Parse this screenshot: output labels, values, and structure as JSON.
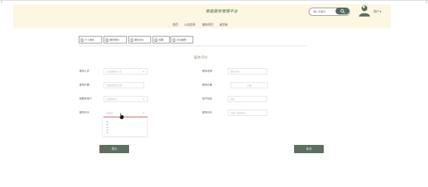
{
  "header": {
    "title": "家庭服务管理平台",
    "search_placeholder": "输入关键词",
    "username": "用户"
  },
  "nav": [
    "首页",
    "公告信息",
    "服务项目",
    "留言板"
  ],
  "tabs": [
    "个人首页",
    "服务预约",
    "服务评价",
    "收藏",
    "评论管理"
  ],
  "form": {
    "title": "服务评价",
    "fields": [
      {
        "label": "服务人员",
        "value": "请选择服务人员"
      },
      {
        "label": "服务名称",
        "value": "服务名称"
      },
      {
        "label": "服务日期",
        "value": "请选择服务日期"
      },
      {
        "label": "服务价格",
        "value": "价格"
      },
      {
        "label": "被服务用户",
        "value": "请选择用户"
      },
      {
        "label": "用户地址",
        "value": "地址"
      },
      {
        "label": "服务评分",
        "value": "请选择"
      },
      {
        "label": "服务评价",
        "value": "请输入服务评价"
      }
    ],
    "submit_label": "提交",
    "cancel_label": "取消"
  },
  "colors": {
    "accent": "#5f6e5e",
    "header_bg": "#fdf6e3",
    "brand_text": "#7a9a68",
    "error": "#e06666"
  }
}
